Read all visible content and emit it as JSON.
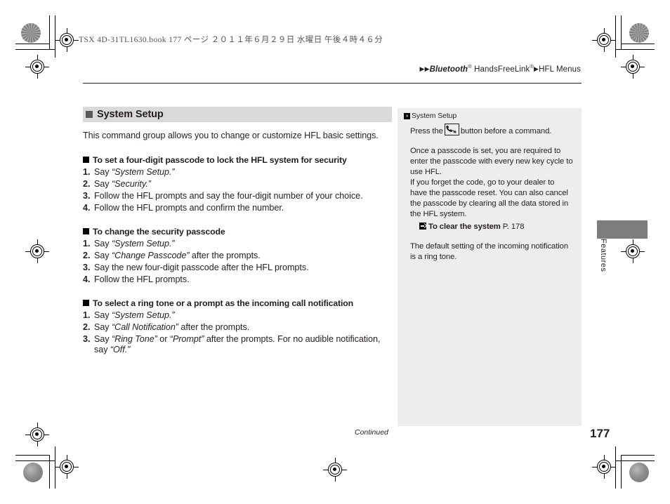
{
  "print_header": "TSX 4D-31TL1630.book  177 ページ  ２０１１年６月２９日  水曜日  午後４時４６分",
  "breadcrumb": {
    "arrow": "▶",
    "item1_italic": "Bluetooth",
    "item1_sup": "®",
    "item2": "HandsFreeLink",
    "item2_sup": "®",
    "item3": "HFL Menus"
  },
  "section": {
    "title": "System Setup",
    "intro": "This command group allows you to change or customize HFL basic settings."
  },
  "tasks": [
    {
      "title": "To set a four-digit passcode to lock the HFL system for security",
      "steps": [
        {
          "pre": "Say ",
          "quote": "“System Setup.”",
          "post": ""
        },
        {
          "pre": "Say ",
          "quote": "“Security.”",
          "post": ""
        },
        {
          "pre": "Follow the HFL prompts and say the four-digit number of your choice.",
          "quote": "",
          "post": ""
        },
        {
          "pre": "Follow the HFL prompts and confirm the number.",
          "quote": "",
          "post": ""
        }
      ]
    },
    {
      "title": "To change the security passcode",
      "steps": [
        {
          "pre": "Say ",
          "quote": "“System Setup.”",
          "post": ""
        },
        {
          "pre": "Say ",
          "quote": "“Change Passcode”",
          "post": " after the prompts."
        },
        {
          "pre": "Say the new four-digit passcode after the HFL prompts.",
          "quote": "",
          "post": ""
        },
        {
          "pre": "Follow the HFL prompts.",
          "quote": "",
          "post": ""
        }
      ]
    },
    {
      "title": "To select a ring tone or a prompt as the incoming call notification",
      "steps": [
        {
          "pre": "Say ",
          "quote": "“System Setup.”",
          "post": ""
        },
        {
          "pre": "Say ",
          "quote": "“Call Notification”",
          "post": " after the prompts."
        },
        {
          "pre": "Say ",
          "quote": "“Ring Tone”",
          "post": " or ",
          "quote2": "“Prompt”",
          "post2": " after the prompts. For no audible notification, say ",
          "quote3": "“Off.”"
        }
      ]
    }
  ],
  "sidenote": {
    "title": "System Setup",
    "line_before_icon": "Press the",
    "icon_name": "hfl-talk-button-icon",
    "line_after_icon": "button before a command.",
    "paragraph2_a": "Once a passcode is set, you are required to enter the passcode with every new key cycle to use HFL.",
    "paragraph2_b": "If you forget the code, go to your dealer to have the passcode reset. You can also cancel the passcode by clearing all the data stored in the HFL system.",
    "xref_label": "To clear the system",
    "xref_page": "P. 178",
    "paragraph3": "The default setting of the incoming notification is a ring tone."
  },
  "edge_tab": {
    "label": "Features",
    "color": "#7d7d7d"
  },
  "footer": {
    "continued": "Continued",
    "page_number": "177"
  }
}
